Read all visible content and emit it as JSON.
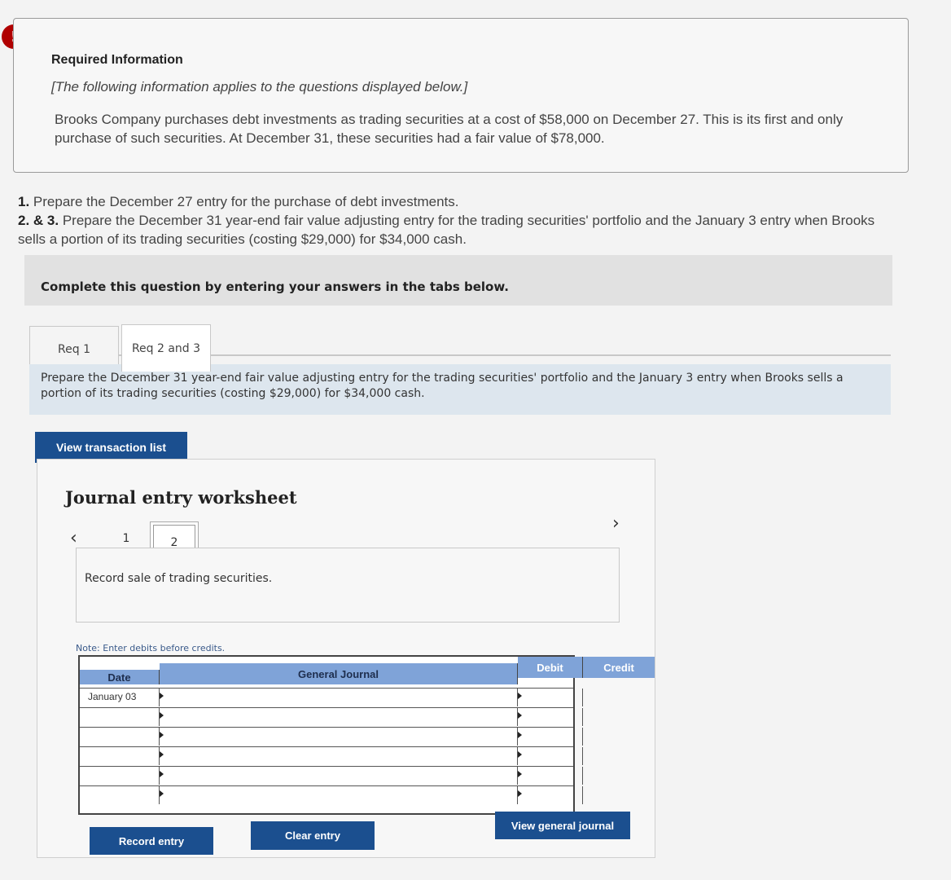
{
  "required": {
    "title": "Required Information",
    "note": "[The following information applies to the questions displayed below.]",
    "body": "Brooks Company purchases debt investments as trading securities at a cost of $58,000 on December 27. This is its first and only purchase of such securities. At December 31, these securities had a fair value of $78,000."
  },
  "questions": {
    "q1_num": "1.",
    "q1_text": "Prepare the December 27 entry for the purchase of debt investments.",
    "q23_num": "2. & 3.",
    "q23_text": "Prepare the December 31 year-end fair value adjusting entry for the trading securities' portfolio and the January 3 entry when Brooks sells a portion of its trading securities (costing $29,000) for $34,000 cash."
  },
  "complete_bar": "Complete this question by entering your answers in the tabs below.",
  "tabs": [
    {
      "label": "Req 1"
    },
    {
      "label": "Req 2 and 3"
    }
  ],
  "instruction": "Prepare the December 31 year-end fair value adjusting entry for the trading securities' portfolio and the January 3 entry when Brooks sells a portion of its trading securities (costing $29,000) for $34,000 cash.",
  "buttons": {
    "view_transactions": "View transaction list",
    "record_entry": "Record entry",
    "clear_entry": "Clear entry",
    "view_general_journal": "View general journal"
  },
  "worksheet": {
    "title": "Journal entry worksheet",
    "prev_icon": "chevron-left-icon",
    "next_icon": "chevron-right-icon",
    "pages": [
      "1",
      "2"
    ],
    "current_page": "2",
    "description": "Record sale of trading securities.",
    "note": "Note: Enter debits before credits."
  },
  "journal": {
    "headers": {
      "date": "Date",
      "general_journal": "General Journal",
      "debit": "Debit",
      "credit": "Credit"
    },
    "rows": [
      {
        "date": "January 03",
        "account": "",
        "debit": "",
        "credit": ""
      },
      {
        "date": "",
        "account": "",
        "debit": "",
        "credit": ""
      },
      {
        "date": "",
        "account": "",
        "debit": "",
        "credit": ""
      },
      {
        "date": "",
        "account": "",
        "debit": "",
        "credit": ""
      },
      {
        "date": "",
        "account": "",
        "debit": "",
        "credit": ""
      },
      {
        "date": "",
        "account": "",
        "debit": "",
        "credit": ""
      }
    ]
  },
  "colors": {
    "button_blue": "#1b4f8f",
    "header_blue": "#7fa3d8",
    "alert_red": "#b00000"
  }
}
